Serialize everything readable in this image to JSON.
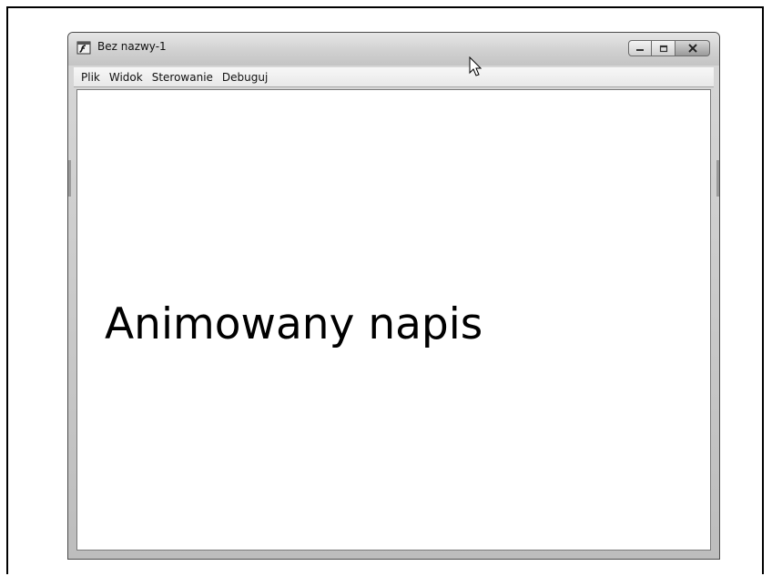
{
  "window": {
    "title": "Bez nazwy-1"
  },
  "menu": {
    "items": [
      "Plik",
      "Widok",
      "Sterowanie",
      "Debuguj"
    ]
  },
  "content": {
    "text": "Animowany napis"
  },
  "icons": {
    "app": "flash-player-icon",
    "minimize": "minimize-icon",
    "maximize": "maximize-icon",
    "close": "close-icon",
    "cursor": "mouse-pointer-icon"
  },
  "colors": {
    "text": "#000000",
    "chrome": "#cfcfcf",
    "client_bg": "#ffffff"
  }
}
